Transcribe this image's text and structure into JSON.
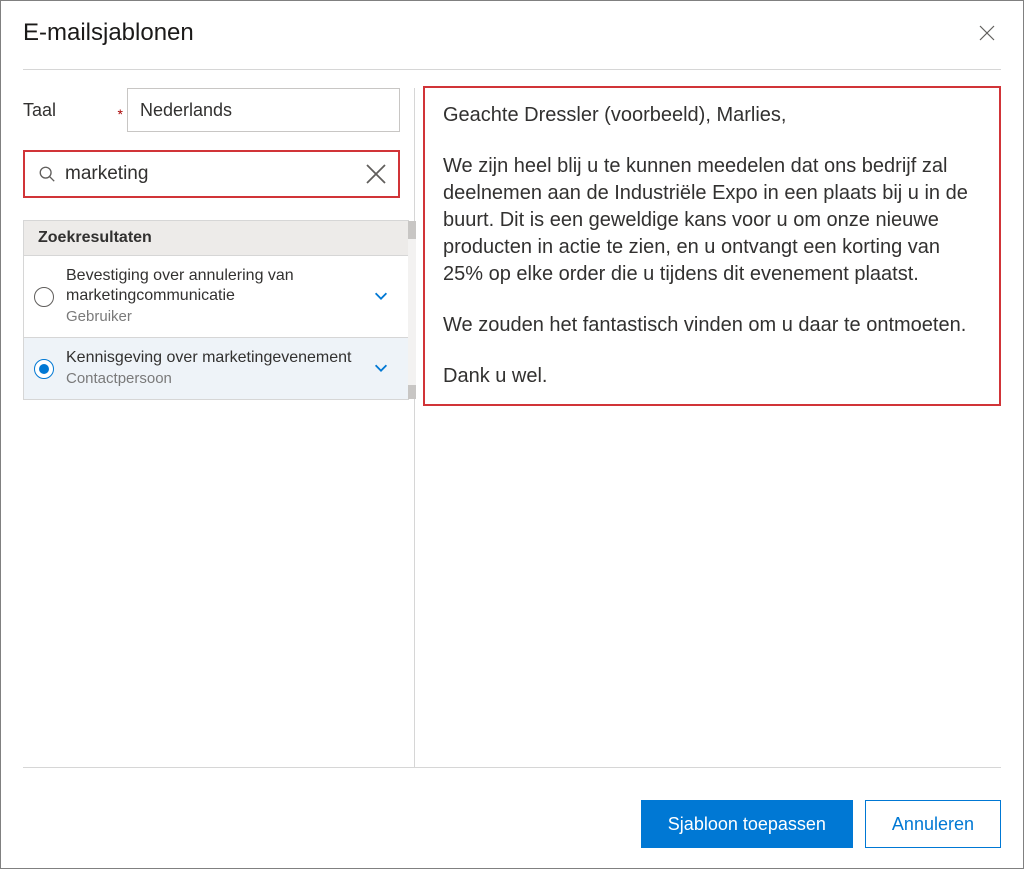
{
  "header": {
    "title": "E-mailsjablonen"
  },
  "language": {
    "label": "Taal",
    "value": "Nederlands"
  },
  "search": {
    "value": "marketing"
  },
  "results": {
    "header": "Zoekresultaten",
    "items": [
      {
        "selected": false,
        "title": "Bevestiging over annulering van marketingcommunicatie",
        "subtitle": "Gebruiker"
      },
      {
        "selected": true,
        "title": "Kennisgeving over marketingevenement",
        "subtitle": "Contactpersoon"
      }
    ]
  },
  "preview": {
    "p1": "Geachte Dressler (voorbeeld), Marlies,",
    "p2": "We zijn heel blij u te kunnen meedelen dat ons bedrijf zal deelnemen aan de Industriële Expo in een plaats bij u in de buurt. Dit is een geweldige kans voor u om onze nieuwe producten in actie te zien, en u ontvangt een korting van 25% op elke order die u tijdens dit evenement plaatst.",
    "p3": "We zouden het fantastisch vinden om u daar te ontmoeten.",
    "p4": "Dank u wel."
  },
  "footer": {
    "apply": "Sjabloon toepassen",
    "cancel": "Annuleren"
  }
}
